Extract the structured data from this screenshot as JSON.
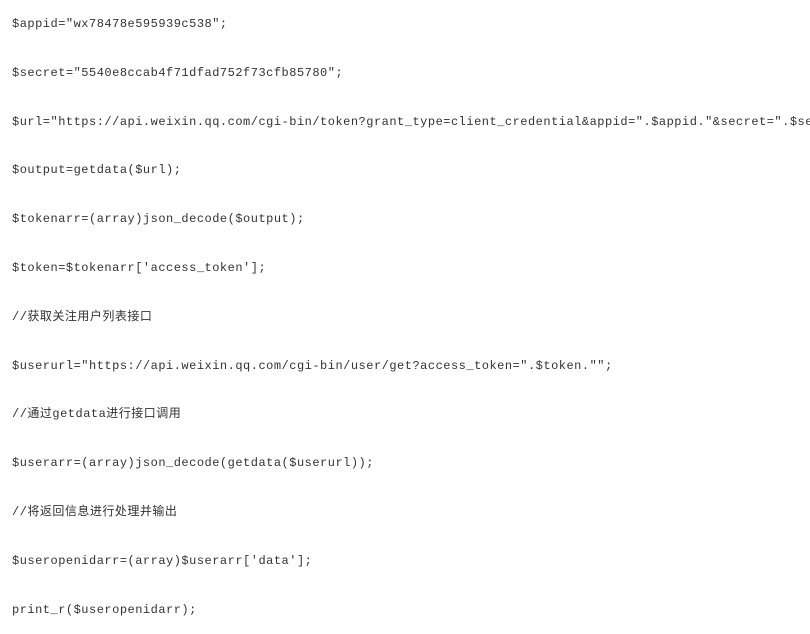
{
  "code_lines": [
    "$appid=\"wx78478e595939c538\";",
    "$secret=\"5540e8ccab4f71dfad752f73cfb85780\";",
    "$url=\"https://api.weixin.qq.com/cgi-bin/token?grant_type=client_credential&appid=\".$appid.\"&secret=\".$secret.\"\";",
    "$output=getdata($url);",
    "$tokenarr=(array)json_decode($output);",
    "$token=$tokenarr['access_token'];",
    "//获取关注用户列表接口",
    "$userurl=\"https://api.weixin.qq.com/cgi-bin/user/get?access_token=\".$token.\"\";",
    "//通过getdata进行接口调用",
    "$userarr=(array)json_decode(getdata($userurl));",
    "//将返回信息进行处理并输出",
    "$useropenidarr=(array)$userarr['data'];",
    "print_r($useropenidarr);"
  ]
}
